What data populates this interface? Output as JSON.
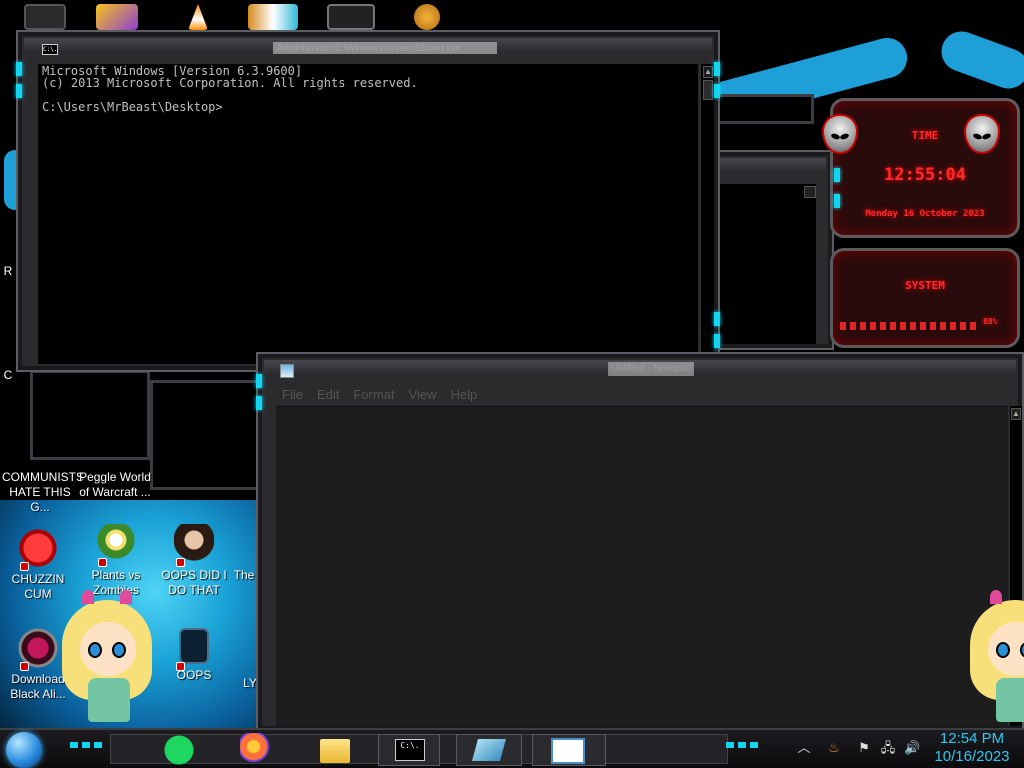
{
  "cmd": {
    "title": "Administrator: C:\\Windows\\system32\\cmd.exe",
    "icon_text": "C:\\.",
    "lines": [
      "Microsoft Windows [Version 6.3.9600]",
      "(c) 2013 Microsoft Corporation. All rights reserved.",
      "",
      "C:\\Users\\MrBeast\\Desktop>"
    ]
  },
  "notepad": {
    "title": "Untitled - Notepad",
    "menus": [
      "File",
      "Edit",
      "Format",
      "View",
      "Help"
    ]
  },
  "gadget": {
    "time_label": "TIME",
    "time": "12:55:04",
    "date": "Monday 16 October 2023",
    "system_label": "SYSTEM",
    "cpu_percent": "88%"
  },
  "desktop_icons": [
    {
      "label": "COMMUNISTS HATE THIS G...",
      "name": "communists-icon"
    },
    {
      "label": "Peggle World of Warcraft ...",
      "name": "peggle-icon"
    },
    {
      "label": "CHUZZIN CUM",
      "name": "chuzzle-icon"
    },
    {
      "label": "Plants vs Zombies",
      "name": "plants-vs-zombies-icon"
    },
    {
      "label": "OOPS DID I DO THAT",
      "name": "oops-did-i-do-that-icon"
    },
    {
      "label": "The",
      "name": "the-icon"
    },
    {
      "label": "Download Black Ali...",
      "name": "download-black-ali-icon"
    },
    {
      "label": "OOPS",
      "name": "oops-icon"
    },
    {
      "label": "LY",
      "name": "ly-icon"
    },
    {
      "label": "R",
      "name": "r-icon"
    },
    {
      "label": "C",
      "name": "c-icon"
    }
  ],
  "taskbar": {
    "clock_time": "12:54 PM",
    "clock_date": "10/16/2023",
    "pinned": [
      "start-orb",
      "spotify-icon",
      "firefox-icon",
      "file-explorer-icon"
    ],
    "tasks": [
      "cmd-task",
      "notepad-task",
      "notepad-window-task"
    ],
    "tray": [
      "chevron-up-icon",
      "java-icon",
      "flag-icon",
      "network-icon",
      "volume-icon"
    ],
    "tray_glyphs": [
      "︿",
      "♨",
      "⚑",
      "🖧",
      "🔊"
    ]
  }
}
